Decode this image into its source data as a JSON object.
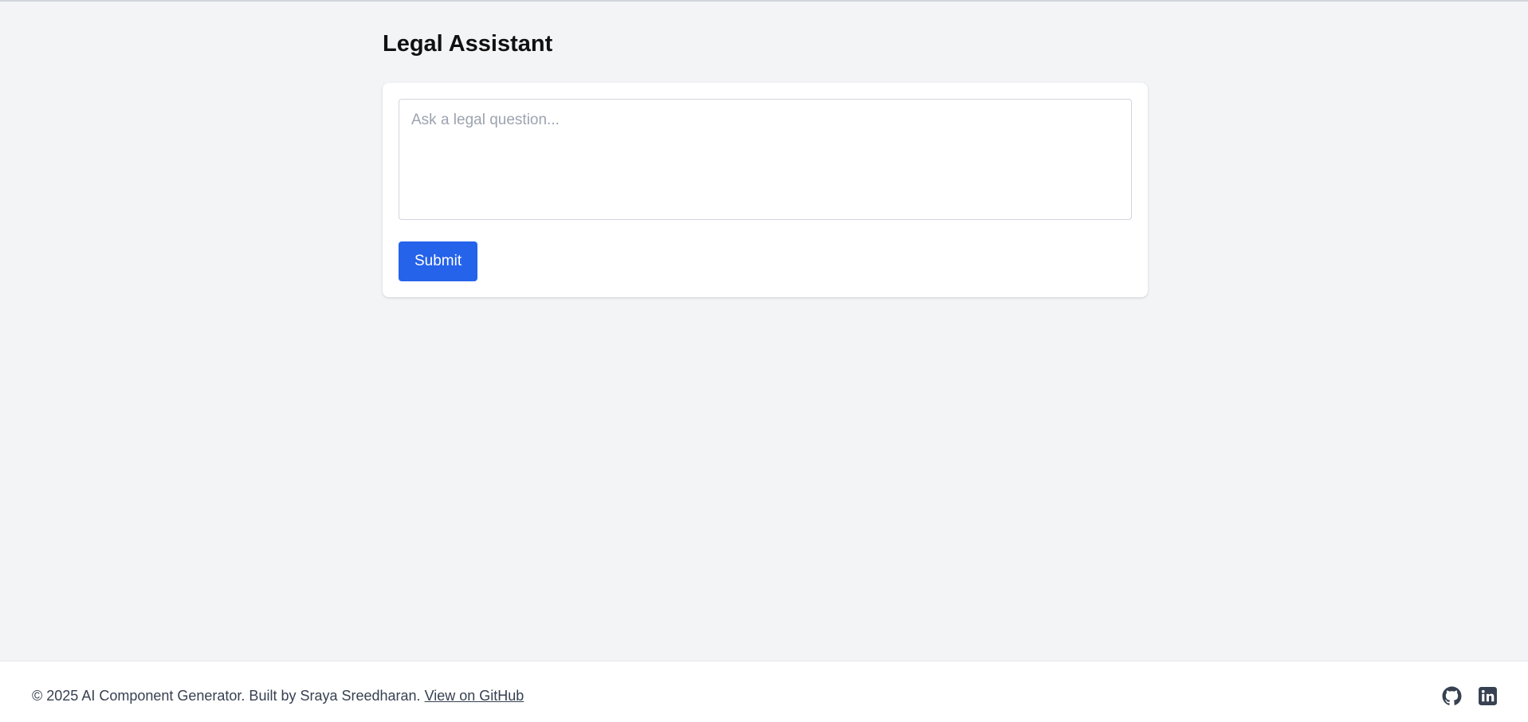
{
  "page": {
    "title": "Legal Assistant"
  },
  "form": {
    "question_placeholder": "Ask a legal question...",
    "question_value": "",
    "submit_label": "Submit"
  },
  "footer": {
    "text": "© 2025 AI Component Generator. Built by Sraya Sreedharan.",
    "github_link_label": "View on GitHub",
    "icons": [
      "github-icon",
      "linkedin-icon"
    ]
  },
  "colors": {
    "background": "#f3f4f6",
    "card": "#ffffff",
    "accent": "#2563eb",
    "footer_text": "#374151",
    "placeholder": "#9ca3af"
  }
}
